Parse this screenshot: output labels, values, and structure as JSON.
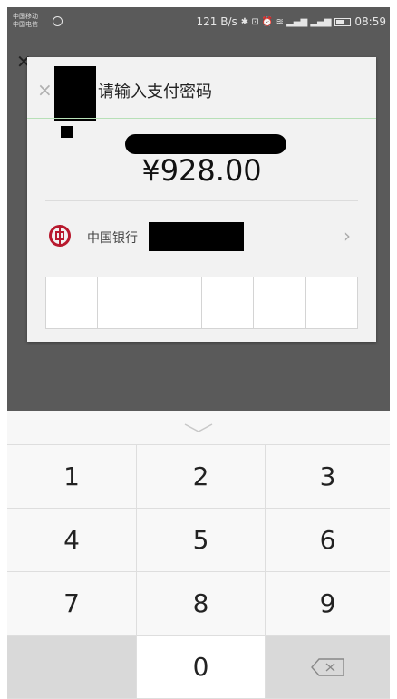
{
  "status_bar": {
    "carrier_1": "中国移动",
    "carrier_2": "中国电信",
    "net_speed": "121 B/s",
    "icons_text": "✱ ⊡ ⏰ ≋ ▂▄▆ ▂▄▆",
    "time": "08:59"
  },
  "dialog": {
    "title": "请输入支付密码",
    "amount": "¥928.00",
    "bank_name": "中国银行",
    "pin_cells": 6
  },
  "keypad": {
    "keys": [
      "1",
      "2",
      "3",
      "4",
      "5",
      "6",
      "7",
      "8",
      "9",
      "",
      "0",
      "delete"
    ]
  },
  "colors": {
    "bank_red": "#b8192e",
    "divider_green": "#b7e0b7",
    "overlay": "#5a5a5a"
  }
}
